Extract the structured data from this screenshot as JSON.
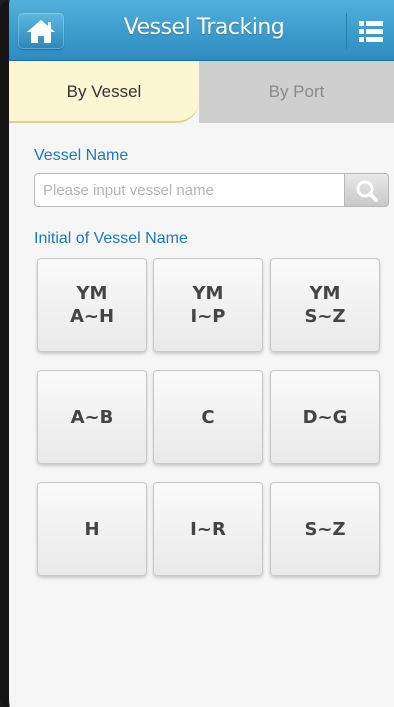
{
  "header": {
    "title": "Vessel Tracking",
    "home_icon": "home-icon",
    "menu_icon": "list-menu-icon",
    "bar_color": "#3a9dcf"
  },
  "tabs": [
    {
      "label": "By Vessel",
      "active": true
    },
    {
      "label": "By Port",
      "active": false
    }
  ],
  "search": {
    "label": "Vessel Name",
    "placeholder": "Please input vessel name",
    "value": "",
    "icon": "search-icon"
  },
  "initials": {
    "label": "Initial of Vessel Name",
    "buttons": [
      {
        "line1": "YM",
        "line2": "A~H"
      },
      {
        "line1": "YM",
        "line2": "I~P"
      },
      {
        "line1": "YM",
        "line2": "S~Z"
      },
      {
        "line1": "A~B",
        "line2": ""
      },
      {
        "line1": "C",
        "line2": ""
      },
      {
        "line1": "D~G",
        "line2": ""
      },
      {
        "line1": "H",
        "line2": ""
      },
      {
        "line1": "I~R",
        "line2": ""
      },
      {
        "line1": "S~Z",
        "line2": ""
      }
    ]
  }
}
